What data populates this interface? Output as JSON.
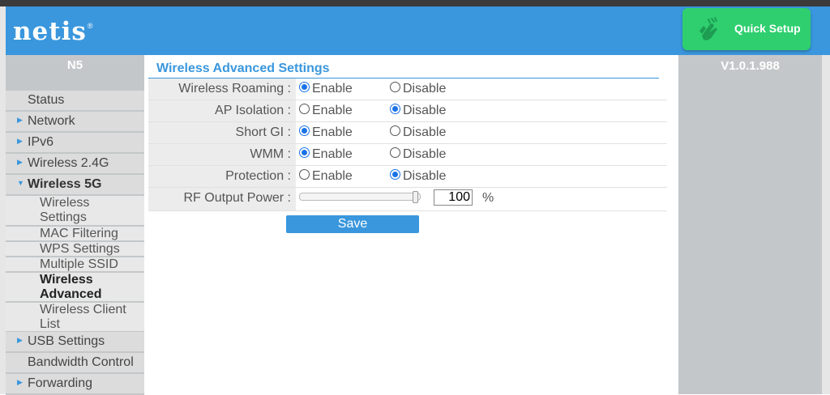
{
  "header": {
    "logo_text": "netis",
    "logo_mark": "®",
    "quick_setup_label": "Quick Setup",
    "brand_color": "#3a97dd",
    "quick_setup_color": "#2fcf6f"
  },
  "sidebar": {
    "model": "N5",
    "items": [
      {
        "label": "Status",
        "arrow": ""
      },
      {
        "label": "Network",
        "arrow": "▶"
      },
      {
        "label": "IPv6",
        "arrow": "▶"
      },
      {
        "label": "Wireless 2.4G",
        "arrow": "▶"
      },
      {
        "label": "Wireless 5G",
        "arrow": "▼"
      },
      {
        "label": "USB Settings",
        "arrow": "▶"
      },
      {
        "label": "Bandwidth Control",
        "arrow": ""
      },
      {
        "label": "Forwarding",
        "arrow": "▶"
      }
    ],
    "subitems": [
      {
        "label": "Wireless Settings"
      },
      {
        "label": "MAC Filtering"
      },
      {
        "label": "WPS Settings"
      },
      {
        "label": "Multiple SSID"
      },
      {
        "label": "Wireless Advanced"
      },
      {
        "label": "Wireless Client List"
      }
    ]
  },
  "right_panel": {
    "version": "V1.0.1.988"
  },
  "main": {
    "title": "Wireless Advanced Settings",
    "enable_label": "Enable",
    "disable_label": "Disable",
    "rows": [
      {
        "label": "Wireless Roaming :",
        "value": "Enable"
      },
      {
        "label": "AP Isolation :",
        "value": "Disable"
      },
      {
        "label": "Short GI :",
        "value": "Enable"
      },
      {
        "label": "WMM :",
        "value": "Enable"
      },
      {
        "label": "Protection :",
        "value": "Disable"
      }
    ],
    "rf_power": {
      "label": "RF Output Power :",
      "value": "100",
      "unit": "%",
      "slider_level_percent": 100
    },
    "save_label": "Save"
  }
}
